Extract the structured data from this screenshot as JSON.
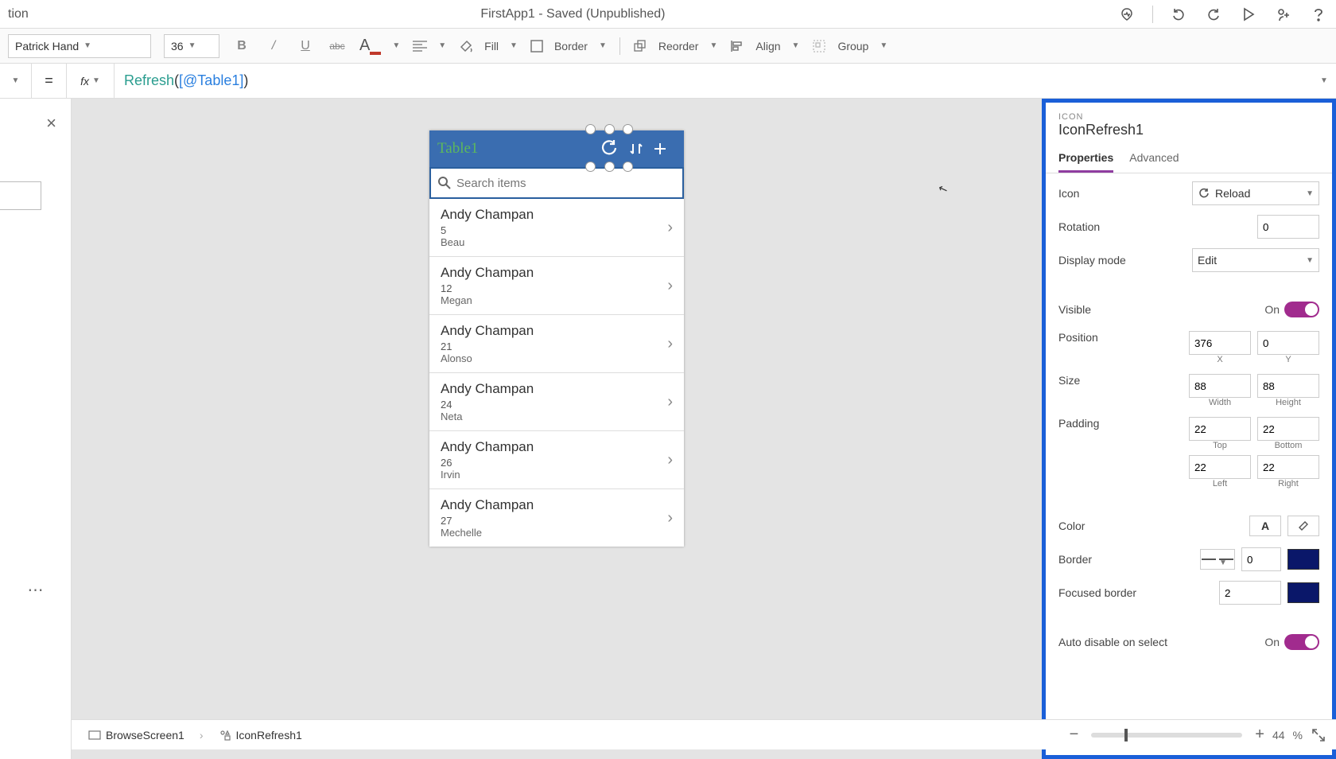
{
  "titlebar": {
    "left_fragment": "tion",
    "center": "FirstApp1 - Saved (Unpublished)"
  },
  "formatbar": {
    "font": "Patrick Hand",
    "size": "36",
    "fill_label": "Fill",
    "border_label": "Border",
    "reorder_label": "Reorder",
    "align_label": "Align",
    "group_label": "Group"
  },
  "formula": {
    "eq": "=",
    "fx": "fx",
    "fn": "Refresh",
    "open": "(",
    "arg": "[@Table1]",
    "close": ")"
  },
  "app": {
    "title": "Table1",
    "search_placeholder": "Search items",
    "items": [
      {
        "title": "Andy Champan",
        "line1": "5",
        "line2": "Beau"
      },
      {
        "title": "Andy Champan",
        "line1": "12",
        "line2": "Megan"
      },
      {
        "title": "Andy Champan",
        "line1": "21",
        "line2": "Alonso"
      },
      {
        "title": "Andy Champan",
        "line1": "24",
        "line2": "Neta"
      },
      {
        "title": "Andy Champan",
        "line1": "26",
        "line2": "Irvin"
      },
      {
        "title": "Andy Champan",
        "line1": "27",
        "line2": "Mechelle"
      }
    ]
  },
  "panel": {
    "type_label": "ICON",
    "name": "IconRefresh1",
    "tabs": {
      "properties": "Properties",
      "advanced": "Advanced"
    },
    "rows": {
      "icon_label": "Icon",
      "icon_value": "Reload",
      "rotation_label": "Rotation",
      "rotation_value": "0",
      "display_mode_label": "Display mode",
      "display_mode_value": "Edit",
      "visible_label": "Visible",
      "visible_state": "On",
      "position_label": "Position",
      "pos_x": "376",
      "pos_y": "0",
      "pos_x_sub": "X",
      "pos_y_sub": "Y",
      "size_label": "Size",
      "size_w": "88",
      "size_h": "88",
      "size_w_sub": "Width",
      "size_h_sub": "Height",
      "padding_label": "Padding",
      "pad_t": "22",
      "pad_b": "22",
      "pad_l": "22",
      "pad_r": "22",
      "pad_t_sub": "Top",
      "pad_b_sub": "Bottom",
      "pad_l_sub": "Left",
      "pad_r_sub": "Right",
      "color_label": "Color",
      "border_label": "Border",
      "border_value": "0",
      "focused_label": "Focused border",
      "focused_value": "2",
      "auto_disable_label": "Auto disable on select",
      "auto_disable_state": "On"
    }
  },
  "status": {
    "bc1": "BrowseScreen1",
    "bc2": "IconRefresh1",
    "zoom_value": "44",
    "zoom_pct": "%"
  }
}
